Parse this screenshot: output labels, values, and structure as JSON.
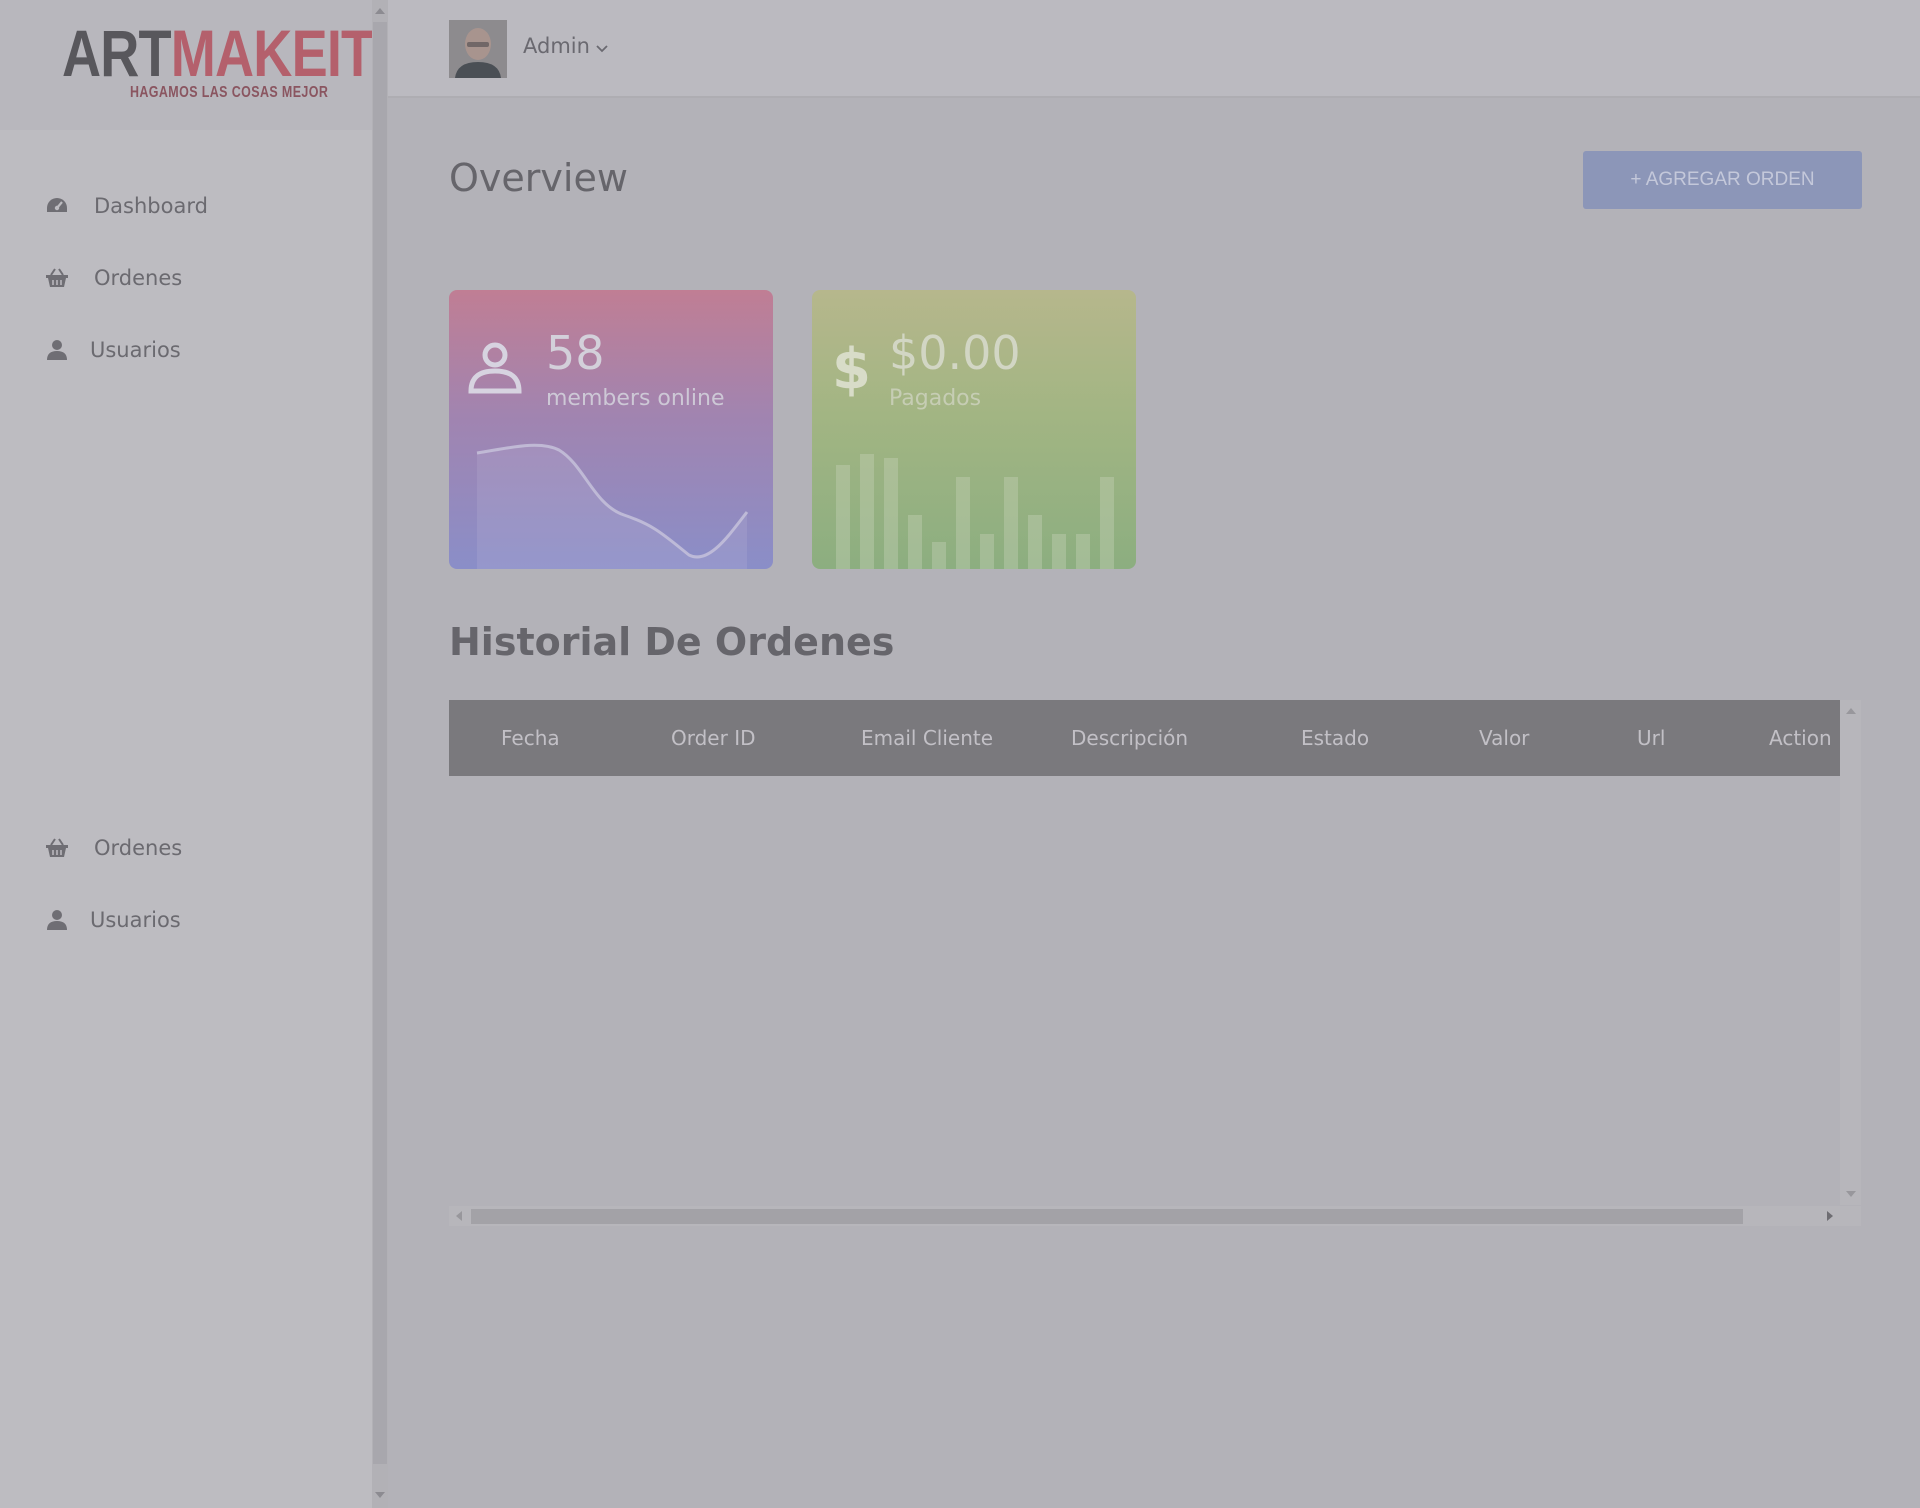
{
  "brand": {
    "logo_part1": "ART",
    "logo_part2": "MAKEIT",
    "tagline": "HAGAMOS LAS COSAS MEJOR",
    "accent_color": "#b4606c"
  },
  "sidebar": {
    "items": [
      {
        "label": "Dashboard",
        "icon": "dashboard-gauge-icon"
      },
      {
        "label": "Ordenes",
        "icon": "basket-icon"
      },
      {
        "label": "Usuarios",
        "icon": "user-icon"
      }
    ],
    "secondary_items": [
      {
        "label": "Ordenes",
        "icon": "basket-icon"
      },
      {
        "label": "Usuarios",
        "icon": "user-icon"
      }
    ]
  },
  "header": {
    "user_name": "Admin",
    "dropdown_icon": "chevron-down-icon"
  },
  "main": {
    "title": "Overview",
    "add_button": "+ AGREGAR ORDEN",
    "cards": [
      {
        "value": "58",
        "label": "members online",
        "icon": "person-icon",
        "chart_type": "line"
      },
      {
        "value": "$0.00",
        "label": "Pagados",
        "icon": "dollar-icon",
        "chart_type": "bar"
      }
    ],
    "history_title": "Historial De Ordenes",
    "table": {
      "columns": [
        "Fecha",
        "Order ID",
        "Email Cliente",
        "Descripción",
        "Estado",
        "Valor",
        "Url",
        "Action"
      ],
      "rows": []
    }
  }
}
